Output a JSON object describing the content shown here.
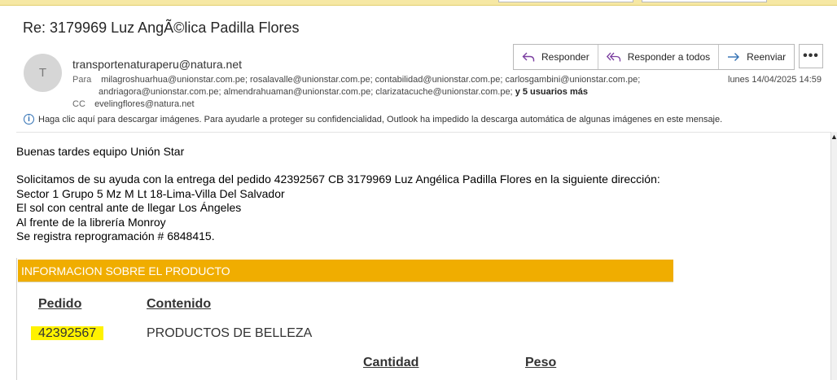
{
  "subject": "Re: 3179969 Luz AngÃ©lica Padilla Flores",
  "sender": {
    "avatar_initial": "T",
    "email": "transportenaturaperu@natura.net"
  },
  "recipients": {
    "to_label": "Para",
    "to_line1": "milagroshuarhua@unionstar.com.pe; rosalavalle@unionstar.com.pe; contabilidad@unionstar.com.pe; carlosgambini@unionstar.com.pe;",
    "to_line2": "andriagora@unionstar.com.pe; almendrahuaman@unionstar.com.pe; clarizatacuche@unionstar.com.pe;",
    "more": "y 5 usuarios más",
    "cc_label": "CC",
    "cc": "evelingflores@natura.net"
  },
  "date": "lunes 14/04/2025 14:59",
  "actions": {
    "reply": "Responder",
    "reply_all": "Responder a todos",
    "forward": "Reenviar",
    "more": "•••"
  },
  "info_bar": {
    "icon": "info-icon",
    "text": "Haga clic aquí para descargar imágenes. Para ayudarle a proteger su confidencialidad, Outlook ha impedido la descarga automática de algunas imágenes en este mensaje."
  },
  "body": {
    "greeting": "Buenas tardes equipo Unión Star",
    "line1": "Solicitamos de su ayuda con la entrega del pedido 42392567 CB 3179969 Luz Angélica Padilla Flores en la siguiente dirección:",
    "line2": "Sector 1 Grupo 5 Mz M Lt 18-Lima-Villa Del Salvador",
    "line3": "El sol con central ante de llegar Los Ángeles",
    "line4": "Al frente de la librería Monroy",
    "line5": "Se registra reprogramación # 6848415."
  },
  "product": {
    "header": "INFORMACION SOBRE EL PRODUCTO",
    "col_pedido": "Pedido",
    "col_contenido": "Contenido",
    "pedido_value": "42392567",
    "contenido_value": "PRODUCTOS DE BELLEZA",
    "col_cantidad": "Cantidad",
    "col_peso": "Peso"
  },
  "colors": {
    "product_header": "#f0ad00",
    "highlight": "#fff200",
    "info_blue": "#2f6fb3"
  }
}
